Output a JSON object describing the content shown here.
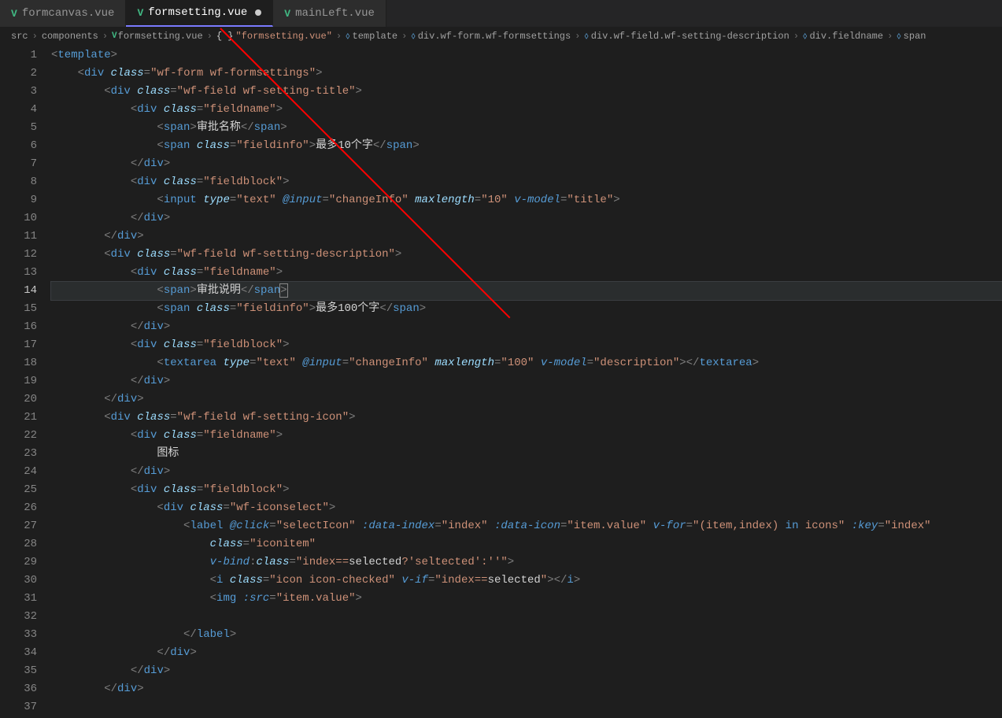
{
  "tabs": [
    {
      "label": "formcanvas.vue",
      "active": false,
      "modified": false
    },
    {
      "label": "formsetting.vue",
      "active": true,
      "modified": true
    },
    {
      "label": "mainLeft.vue",
      "active": false,
      "modified": false
    }
  ],
  "breadcrumb": {
    "parts": [
      "src",
      "components",
      "formsetting.vue",
      "\"formsetting.vue\"",
      "template",
      "div.wf-form.wf-formsettings",
      "div.wf-field.wf-setting-description",
      "div.fieldname",
      "span"
    ]
  },
  "line_count": 37,
  "highlighted_line": 14,
  "code": {
    "l1": {
      "tag": "template"
    },
    "l2": {
      "tag": "div",
      "attr": "class",
      "val": "\"wf-form wf-formsettings\""
    },
    "l3": {
      "tag": "div",
      "attr": "class",
      "val": "\"wf-field wf-setting-title\""
    },
    "l4": {
      "tag": "div",
      "attr": "class",
      "val": "\"fieldname\""
    },
    "l5": {
      "tag": "span",
      "text": "审批名称"
    },
    "l6": {
      "tag": "span",
      "attr": "class",
      "val": "\"fieldinfo\"",
      "text": "最多10个字"
    },
    "l7": {
      "close": "div"
    },
    "l8": {
      "tag": "div",
      "attr": "class",
      "val": "\"fieldblock\""
    },
    "l9": {
      "tag": "input",
      "type": "\"text\"",
      "event": "@input",
      "handler": "\"changeInfo\"",
      "maxlength": "\"10\"",
      "vmodel": "\"title\""
    },
    "l10": {
      "close": "div"
    },
    "l11": {
      "close": "div"
    },
    "l12": {
      "tag": "div",
      "attr": "class",
      "val": "\"wf-field wf-setting-description\""
    },
    "l13": {
      "tag": "div",
      "attr": "class",
      "val": "\"fieldname\""
    },
    "l14": {
      "tag": "span",
      "text": "审批说明"
    },
    "l15": {
      "tag": "span",
      "attr": "class",
      "val": "\"fieldinfo\"",
      "text": "最多100个字"
    },
    "l16": {
      "close": "div"
    },
    "l17": {
      "tag": "div",
      "attr": "class",
      "val": "\"fieldblock\""
    },
    "l18": {
      "tag": "textarea",
      "type": "\"text\"",
      "event": "@input",
      "handler": "\"changeInfo\"",
      "maxlength": "\"100\"",
      "vmodel": "\"description\""
    },
    "l19": {
      "close": "div"
    },
    "l20": {
      "close": "div"
    },
    "l21": {
      "tag": "div",
      "attr": "class",
      "val": "\"wf-field wf-setting-icon\""
    },
    "l22": {
      "tag": "div",
      "attr": "class",
      "val": "\"fieldname\""
    },
    "l23": {
      "text": "图标"
    },
    "l24": {
      "close": "div"
    },
    "l25": {
      "tag": "div",
      "attr": "class",
      "val": "\"fieldblock\""
    },
    "l26": {
      "tag": "div",
      "attr": "class",
      "val": "\"wf-iconselect\""
    },
    "l27": {
      "tag": "label",
      "click": "\"selectIcon\"",
      "dataindex": "\"index\"",
      "dataicon": "\"item.value\"",
      "vfor": "\"(item,index) in icons\"",
      "key": "\"index\""
    },
    "l28": {
      "attr": "class",
      "val": "\"iconitem\""
    },
    "l29": {
      "vbind": "v-bind",
      "bclass": "class",
      "expr": "\"index==selected?'seltected':''\"",
      "selected_word": "selected"
    },
    "l30": {
      "tag": "i",
      "attr": "class",
      "val": "\"icon icon-checked\"",
      "vif": "v-if",
      "cond_l": "\"index==",
      "cond_r": "selected",
      "cond_end": "\""
    },
    "l31": {
      "tag": "img",
      "src": ":src",
      "val": "\"item.value\""
    },
    "l33": {
      "close": "label"
    },
    "l34": {
      "close": "div"
    },
    "l35": {
      "close": "div"
    },
    "l36": {
      "close": "div"
    }
  }
}
